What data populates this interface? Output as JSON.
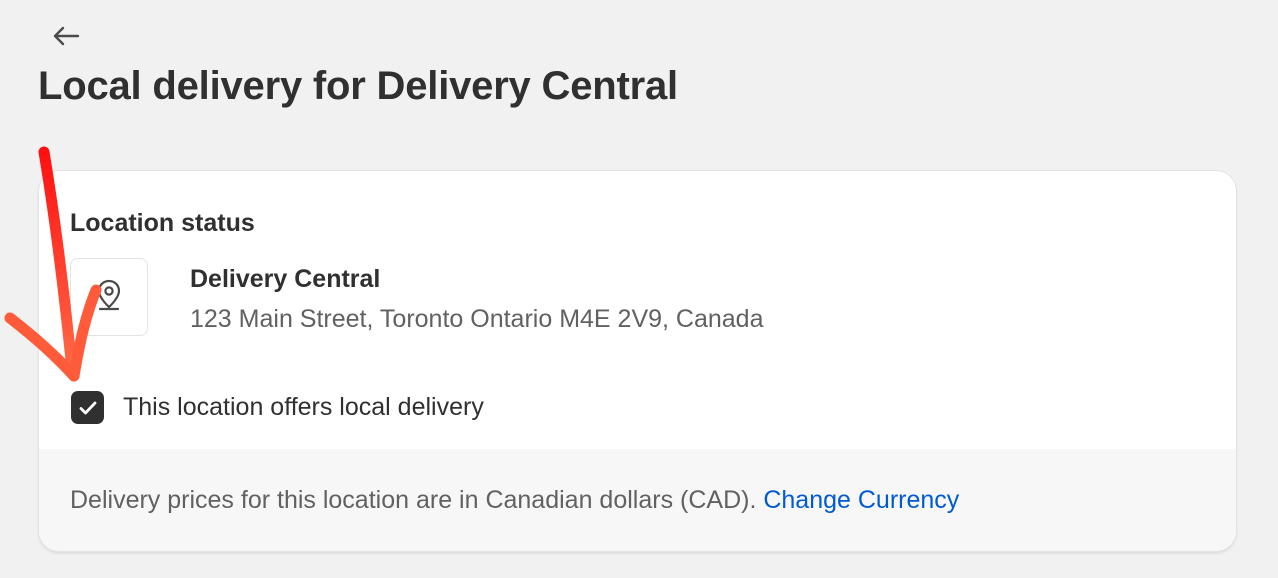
{
  "header": {
    "back_icon": "arrow-left-icon",
    "title": "Local delivery for Delivery Central"
  },
  "location_status": {
    "section_title": "Location status",
    "location_icon": "map-pin-icon",
    "name": "Delivery Central",
    "address": "123 Main Street, Toronto Ontario M4E 2V9, Canada",
    "offers_local_delivery": {
      "label": "This location offers local delivery",
      "checked": true
    }
  },
  "footer": {
    "currency_note": "Delivery prices for this location are in Canadian dollars (CAD).",
    "change_currency_label": "Change Currency"
  },
  "annotation": {
    "type": "red-arrow-icon",
    "color": "#ff3b1f"
  },
  "colors": {
    "background": "#f1f1f1",
    "card": "#ffffff",
    "footer": "#f7f7f7",
    "link": "#005bd3",
    "checkbox": "#303030"
  }
}
